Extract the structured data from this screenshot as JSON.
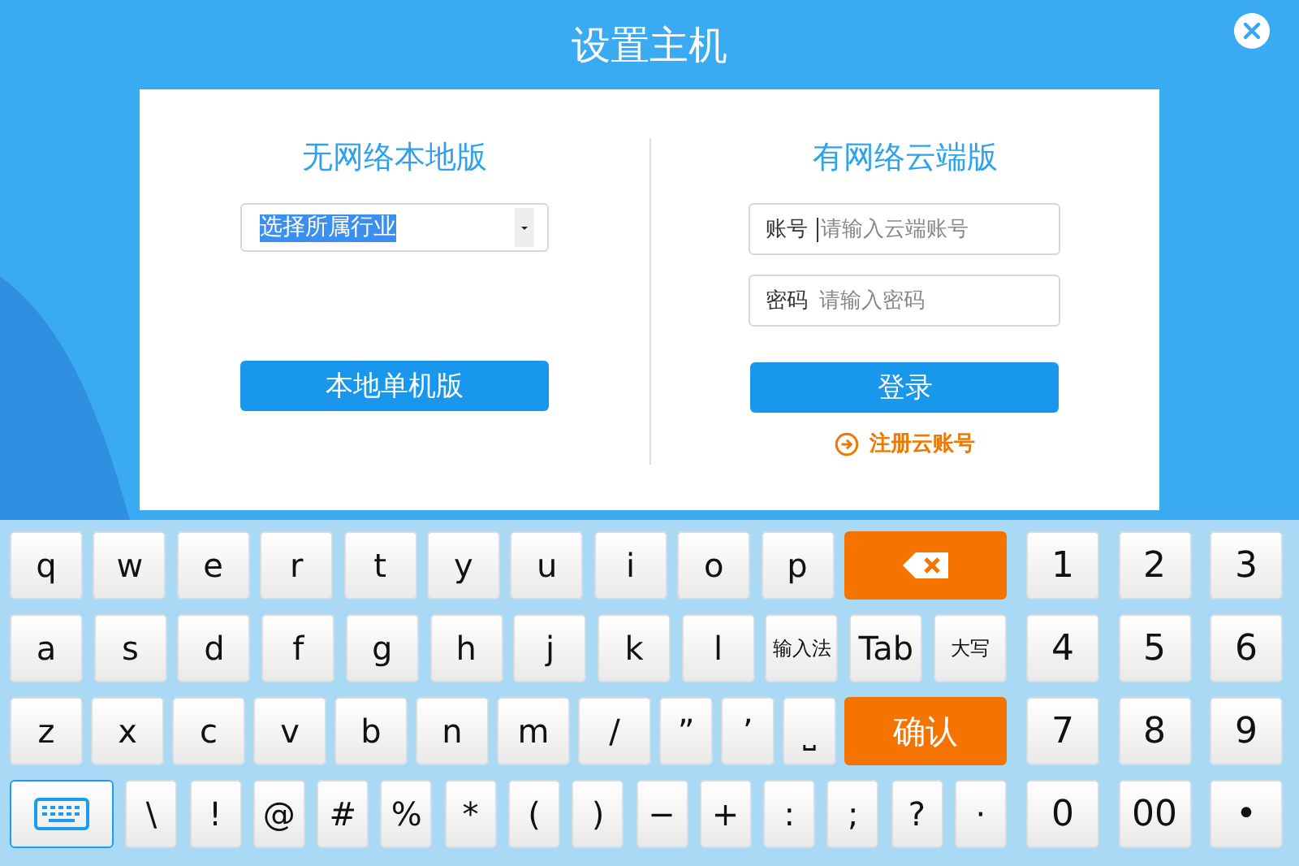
{
  "window": {
    "title": "设置主机"
  },
  "local": {
    "heading": "无网络本地版",
    "select": {
      "value": "选择所属行业",
      "value_highlighted": true
    },
    "button": "本地单机版"
  },
  "cloud": {
    "heading": "有网络云端版",
    "fields": [
      {
        "label": "账号",
        "placeholder": "请输入云端账号",
        "focused": true
      },
      {
        "label": "密码",
        "placeholder": "请输入密码",
        "focused": false
      }
    ],
    "button": "登录",
    "register_link": "注册云账号"
  },
  "keyboard": {
    "rows": [
      {
        "keys": [
          {
            "kind": "key",
            "label": "q"
          },
          {
            "kind": "key",
            "label": "w"
          },
          {
            "kind": "key",
            "label": "e"
          },
          {
            "kind": "key",
            "label": "r"
          },
          {
            "kind": "key",
            "label": "t"
          },
          {
            "kind": "key",
            "label": "y"
          },
          {
            "kind": "key",
            "label": "u"
          },
          {
            "kind": "key",
            "label": "i"
          },
          {
            "kind": "key",
            "label": "o"
          },
          {
            "kind": "key",
            "label": "p"
          },
          {
            "kind": "backspace"
          }
        ],
        "numpad": [
          "1",
          "2",
          "3"
        ]
      },
      {
        "keys": [
          {
            "kind": "key",
            "label": "a"
          },
          {
            "kind": "key",
            "label": "s"
          },
          {
            "kind": "key",
            "label": "d"
          },
          {
            "kind": "key",
            "label": "f"
          },
          {
            "kind": "key",
            "label": "g"
          },
          {
            "kind": "key",
            "label": "h"
          },
          {
            "kind": "key",
            "label": "j"
          },
          {
            "kind": "key",
            "label": "k"
          },
          {
            "kind": "key",
            "label": "l"
          },
          {
            "kind": "word",
            "label": "输入法"
          },
          {
            "kind": "key",
            "label": "Tab"
          },
          {
            "kind": "word",
            "label": "大写"
          }
        ],
        "numpad": [
          "4",
          "5",
          "6"
        ]
      },
      {
        "keys": [
          {
            "kind": "key",
            "label": "z"
          },
          {
            "kind": "key",
            "label": "x"
          },
          {
            "kind": "key",
            "label": "c"
          },
          {
            "kind": "key",
            "label": "v"
          },
          {
            "kind": "key",
            "label": "b"
          },
          {
            "kind": "key",
            "label": "n"
          },
          {
            "kind": "key",
            "label": "m"
          },
          {
            "kind": "key",
            "label": "/"
          },
          {
            "kind": "small",
            "label": "”"
          },
          {
            "kind": "small",
            "label": "’"
          },
          {
            "kind": "small",
            "label": "⎵"
          },
          {
            "kind": "action",
            "label": "确认"
          }
        ],
        "numpad": [
          "7",
          "8",
          "9"
        ]
      },
      {
        "keys": [
          {
            "kind": "keyboard"
          },
          {
            "kind": "small",
            "label": "\\"
          },
          {
            "kind": "small",
            "label": "!"
          },
          {
            "kind": "small",
            "label": "@"
          },
          {
            "kind": "small",
            "label": "#"
          },
          {
            "kind": "small",
            "label": "%"
          },
          {
            "kind": "small",
            "label": "*"
          },
          {
            "kind": "small",
            "label": "("
          },
          {
            "kind": "small",
            "label": ")"
          },
          {
            "kind": "small",
            "label": "−"
          },
          {
            "kind": "small",
            "label": "+"
          },
          {
            "kind": "small",
            "label": ":"
          },
          {
            "kind": "small",
            "label": ";"
          },
          {
            "kind": "small",
            "label": "?"
          },
          {
            "kind": "small",
            "label": "·"
          }
        ],
        "numpad": [
          "0",
          "00",
          "•"
        ]
      }
    ]
  }
}
